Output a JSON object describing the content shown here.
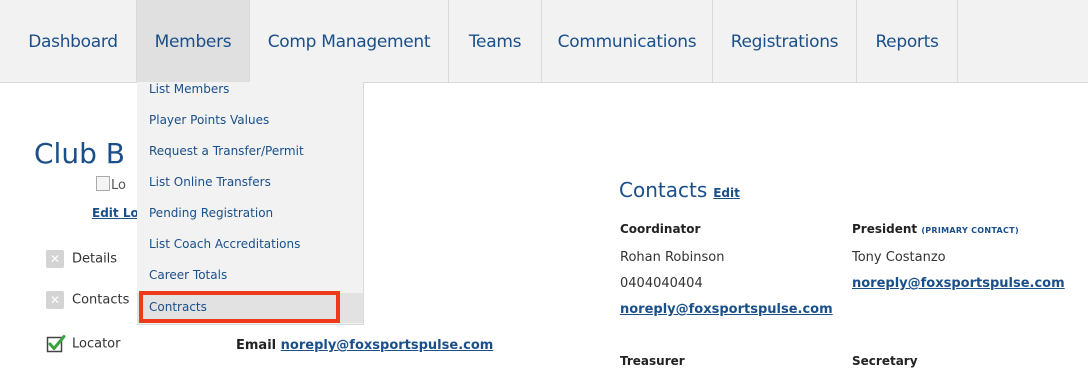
{
  "nav": {
    "items": [
      {
        "label": "Dashboard"
      },
      {
        "label": "Members"
      },
      {
        "label": "Comp Management"
      },
      {
        "label": "Teams"
      },
      {
        "label": "Communications"
      },
      {
        "label": "Registrations"
      },
      {
        "label": "Reports"
      }
    ]
  },
  "members_menu": {
    "items": [
      {
        "label": "List Members"
      },
      {
        "label": "Player Points Values"
      },
      {
        "label": "Request a Transfer/Permit"
      },
      {
        "label": "List Online Transfers"
      },
      {
        "label": "Pending Registration"
      },
      {
        "label": "List Coach Accreditations"
      },
      {
        "label": "Career Totals"
      },
      {
        "label": "Contracts"
      }
    ]
  },
  "page": {
    "title": "Club B",
    "logo_alt_fragment": "Lo",
    "edit_logo_fragment": "Edit Lo",
    "sections": [
      {
        "label": "Details",
        "state": "inactive"
      },
      {
        "label": "Contacts",
        "state": "inactive"
      },
      {
        "label": "Locator",
        "state": "checked"
      }
    ],
    "email_label": "Email",
    "email_value": "noreply@foxsportspulse.com"
  },
  "contacts": {
    "heading": "Contacts",
    "edit_label": "Edit",
    "coordinator": {
      "role": "Coordinator",
      "name": "Rohan Robinson",
      "phone": "0404040404",
      "email": "noreply@foxsportspulse.com"
    },
    "president": {
      "role": "President",
      "tag": "(PRIMARY CONTACT)",
      "name": "Tony Costanzo",
      "email": "noreply@foxsportspulse.com"
    },
    "treasurer_role": "Treasurer",
    "secretary_role": "Secretary"
  },
  "colors": {
    "link_blue": "#1a4f8a",
    "highlight_red": "#ec3a1a",
    "nav_bg": "#f2f2f2"
  }
}
